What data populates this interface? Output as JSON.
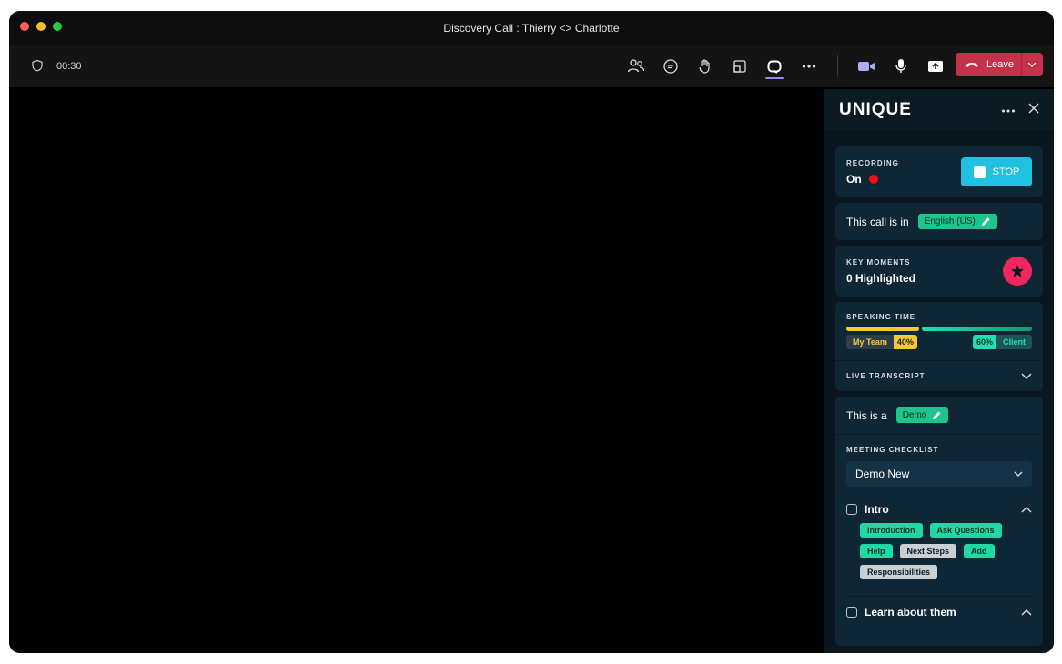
{
  "window": {
    "title": "Discovery Call : Thierry <> Charlotte"
  },
  "toolbar": {
    "timer": "00:30",
    "icons": [
      "people-icon",
      "chat-icon",
      "raise-hand-icon",
      "share-tray-icon",
      "apps-icon",
      "more-icon"
    ],
    "leave_label": "Leave"
  },
  "panel": {
    "logo": "UNIQUE",
    "recording": {
      "label": "RECORDING",
      "status": "On",
      "stop_label": "STOP"
    },
    "language": {
      "prefix": "This call is in",
      "value": "English (US)"
    },
    "key_moments": {
      "label": "KEY MOMENTS",
      "count_text": "0 Highlighted"
    },
    "speaking_time": {
      "label": "SPEAKING TIME",
      "team_label": "My Team",
      "team_pct": "40%",
      "team_value": 40,
      "client_label": "Client",
      "client_pct": "60%",
      "client_value": 60
    },
    "live_transcript": {
      "label": "LIVE TRANSCRIPT"
    },
    "call_type": {
      "prefix": "This is a",
      "value": "Demo"
    },
    "checklist": {
      "label": "MEETING CHECKLIST",
      "selected": "Demo New",
      "sections": [
        {
          "title": "Intro",
          "tags": [
            {
              "text": "Introduction",
              "style": "green"
            },
            {
              "text": "Ask Questions",
              "style": "green"
            },
            {
              "text": "Help",
              "style": "green"
            },
            {
              "text": "Next Steps",
              "style": "grey"
            },
            {
              "text": "Add",
              "style": "green"
            },
            {
              "text": "Responsibilities",
              "style": "grey"
            }
          ]
        },
        {
          "title": "Learn about them",
          "tags": []
        }
      ]
    }
  },
  "colors": {
    "accent_cyan": "#1fc0e0",
    "leave_red": "#c4314b",
    "star_pink": "#f0265f",
    "green": "#1fd8a2",
    "team_yellow": "#f3c93a"
  }
}
